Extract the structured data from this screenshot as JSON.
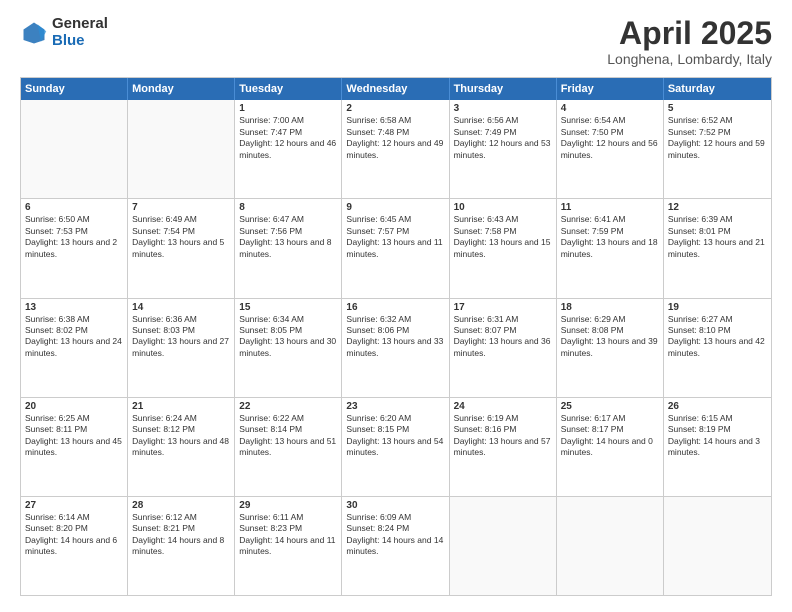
{
  "logo": {
    "general": "General",
    "blue": "Blue"
  },
  "title": "April 2025",
  "subtitle": "Longhena, Lombardy, Italy",
  "header_days": [
    "Sunday",
    "Monday",
    "Tuesday",
    "Wednesday",
    "Thursday",
    "Friday",
    "Saturday"
  ],
  "rows": [
    [
      {
        "day": "",
        "info": ""
      },
      {
        "day": "",
        "info": ""
      },
      {
        "day": "1",
        "info": "Sunrise: 7:00 AM\nSunset: 7:47 PM\nDaylight: 12 hours and 46 minutes."
      },
      {
        "day": "2",
        "info": "Sunrise: 6:58 AM\nSunset: 7:48 PM\nDaylight: 12 hours and 49 minutes."
      },
      {
        "day": "3",
        "info": "Sunrise: 6:56 AM\nSunset: 7:49 PM\nDaylight: 12 hours and 53 minutes."
      },
      {
        "day": "4",
        "info": "Sunrise: 6:54 AM\nSunset: 7:50 PM\nDaylight: 12 hours and 56 minutes."
      },
      {
        "day": "5",
        "info": "Sunrise: 6:52 AM\nSunset: 7:52 PM\nDaylight: 12 hours and 59 minutes."
      }
    ],
    [
      {
        "day": "6",
        "info": "Sunrise: 6:50 AM\nSunset: 7:53 PM\nDaylight: 13 hours and 2 minutes."
      },
      {
        "day": "7",
        "info": "Sunrise: 6:49 AM\nSunset: 7:54 PM\nDaylight: 13 hours and 5 minutes."
      },
      {
        "day": "8",
        "info": "Sunrise: 6:47 AM\nSunset: 7:56 PM\nDaylight: 13 hours and 8 minutes."
      },
      {
        "day": "9",
        "info": "Sunrise: 6:45 AM\nSunset: 7:57 PM\nDaylight: 13 hours and 11 minutes."
      },
      {
        "day": "10",
        "info": "Sunrise: 6:43 AM\nSunset: 7:58 PM\nDaylight: 13 hours and 15 minutes."
      },
      {
        "day": "11",
        "info": "Sunrise: 6:41 AM\nSunset: 7:59 PM\nDaylight: 13 hours and 18 minutes."
      },
      {
        "day": "12",
        "info": "Sunrise: 6:39 AM\nSunset: 8:01 PM\nDaylight: 13 hours and 21 minutes."
      }
    ],
    [
      {
        "day": "13",
        "info": "Sunrise: 6:38 AM\nSunset: 8:02 PM\nDaylight: 13 hours and 24 minutes."
      },
      {
        "day": "14",
        "info": "Sunrise: 6:36 AM\nSunset: 8:03 PM\nDaylight: 13 hours and 27 minutes."
      },
      {
        "day": "15",
        "info": "Sunrise: 6:34 AM\nSunset: 8:05 PM\nDaylight: 13 hours and 30 minutes."
      },
      {
        "day": "16",
        "info": "Sunrise: 6:32 AM\nSunset: 8:06 PM\nDaylight: 13 hours and 33 minutes."
      },
      {
        "day": "17",
        "info": "Sunrise: 6:31 AM\nSunset: 8:07 PM\nDaylight: 13 hours and 36 minutes."
      },
      {
        "day": "18",
        "info": "Sunrise: 6:29 AM\nSunset: 8:08 PM\nDaylight: 13 hours and 39 minutes."
      },
      {
        "day": "19",
        "info": "Sunrise: 6:27 AM\nSunset: 8:10 PM\nDaylight: 13 hours and 42 minutes."
      }
    ],
    [
      {
        "day": "20",
        "info": "Sunrise: 6:25 AM\nSunset: 8:11 PM\nDaylight: 13 hours and 45 minutes."
      },
      {
        "day": "21",
        "info": "Sunrise: 6:24 AM\nSunset: 8:12 PM\nDaylight: 13 hours and 48 minutes."
      },
      {
        "day": "22",
        "info": "Sunrise: 6:22 AM\nSunset: 8:14 PM\nDaylight: 13 hours and 51 minutes."
      },
      {
        "day": "23",
        "info": "Sunrise: 6:20 AM\nSunset: 8:15 PM\nDaylight: 13 hours and 54 minutes."
      },
      {
        "day": "24",
        "info": "Sunrise: 6:19 AM\nSunset: 8:16 PM\nDaylight: 13 hours and 57 minutes."
      },
      {
        "day": "25",
        "info": "Sunrise: 6:17 AM\nSunset: 8:17 PM\nDaylight: 14 hours and 0 minutes."
      },
      {
        "day": "26",
        "info": "Sunrise: 6:15 AM\nSunset: 8:19 PM\nDaylight: 14 hours and 3 minutes."
      }
    ],
    [
      {
        "day": "27",
        "info": "Sunrise: 6:14 AM\nSunset: 8:20 PM\nDaylight: 14 hours and 6 minutes."
      },
      {
        "day": "28",
        "info": "Sunrise: 6:12 AM\nSunset: 8:21 PM\nDaylight: 14 hours and 8 minutes."
      },
      {
        "day": "29",
        "info": "Sunrise: 6:11 AM\nSunset: 8:23 PM\nDaylight: 14 hours and 11 minutes."
      },
      {
        "day": "30",
        "info": "Sunrise: 6:09 AM\nSunset: 8:24 PM\nDaylight: 14 hours and 14 minutes."
      },
      {
        "day": "",
        "info": ""
      },
      {
        "day": "",
        "info": ""
      },
      {
        "day": "",
        "info": ""
      }
    ]
  ]
}
